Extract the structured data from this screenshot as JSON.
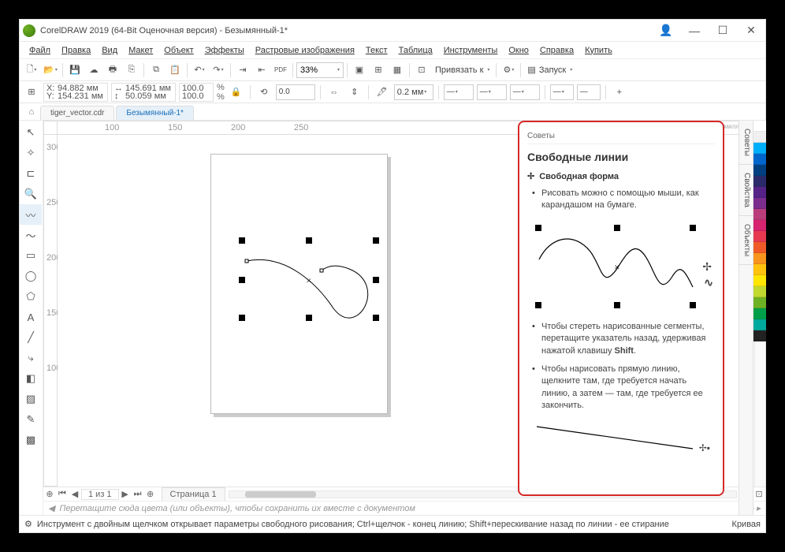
{
  "title": "CorelDRAW 2019 (64-Bit Оценочная версия) - Безымянный-1*",
  "menu": {
    "file": "Файл",
    "edit": "Правка",
    "view": "Вид",
    "layout": "Макет",
    "object": "Объект",
    "effects": "Эффекты",
    "bitmaps": "Растровые изображения",
    "text": "Текст",
    "table": "Таблица",
    "tools": "Инструменты",
    "window": "Окно",
    "help": "Справка",
    "buy": "Купить"
  },
  "toolbar": {
    "zoom": "33%",
    "snap": "Привязать к",
    "launch": "Запуск"
  },
  "propbar": {
    "x": "94.882 мм",
    "y": "154.231 мм",
    "w": "145.691 мм",
    "h": "50.059 мм",
    "sx": "100.0",
    "sy": "100.0",
    "pct": "%",
    "angle": "0.0",
    "outline": "0.2 мм"
  },
  "tabs": {
    "t1": "tiger_vector.cdr",
    "t2": "Безымянный-1*"
  },
  "ruler": {
    "units": "миллиметры",
    "h100": "100",
    "h150": "150",
    "h200": "200",
    "h250": "250",
    "v100": "100",
    "v150": "150",
    "v200": "200",
    "v250": "250",
    "v300": "300"
  },
  "hints": {
    "panelLabel": "Советы",
    "title": "Свободные линии",
    "subtitle": "Свободная форма",
    "bullet1": "Рисовать можно с помощью мыши, как карандашом на бумаге.",
    "bullet2_a": "Чтобы стереть нарисованные сегменты, перетащите указатель назад, удерживая нажатой клавишу ",
    "bullet2_b": "Shift",
    "bullet2_c": ".",
    "bullet3": "Чтобы нарисовать прямую линию, щелкните там, где требуется начать линию, а затем — там, где требуется ее закончить."
  },
  "docks": {
    "d1": "Советы",
    "d2": "Свойства",
    "d3": "Объекты"
  },
  "pageNav": {
    "counter": "1 из 1",
    "pageTab": "Страница 1"
  },
  "colorTray": "Перетащите сюда цвета (или объекты), чтобы сохранить их вместе с документом",
  "status": {
    "main": "Инструмент с двойным щелчком открывает параметры свободного рисования; Ctrl+щелчок - конец линию; Shift+перескивание назад по линии - ее стирание",
    "right": "Кривая"
  },
  "palette": [
    "#ffffff",
    "#f0f0f0",
    "#00affa",
    "#0066cc",
    "#003f7f",
    "#2a2a6a",
    "#552288",
    "#7b2d8e",
    "#b83d7a",
    "#d6246e",
    "#e63950",
    "#f05a28",
    "#f7941d",
    "#ffc20e",
    "#ffe600",
    "#c1d82f",
    "#6eb122",
    "#009e49",
    "#00a99d",
    "#222222"
  ]
}
